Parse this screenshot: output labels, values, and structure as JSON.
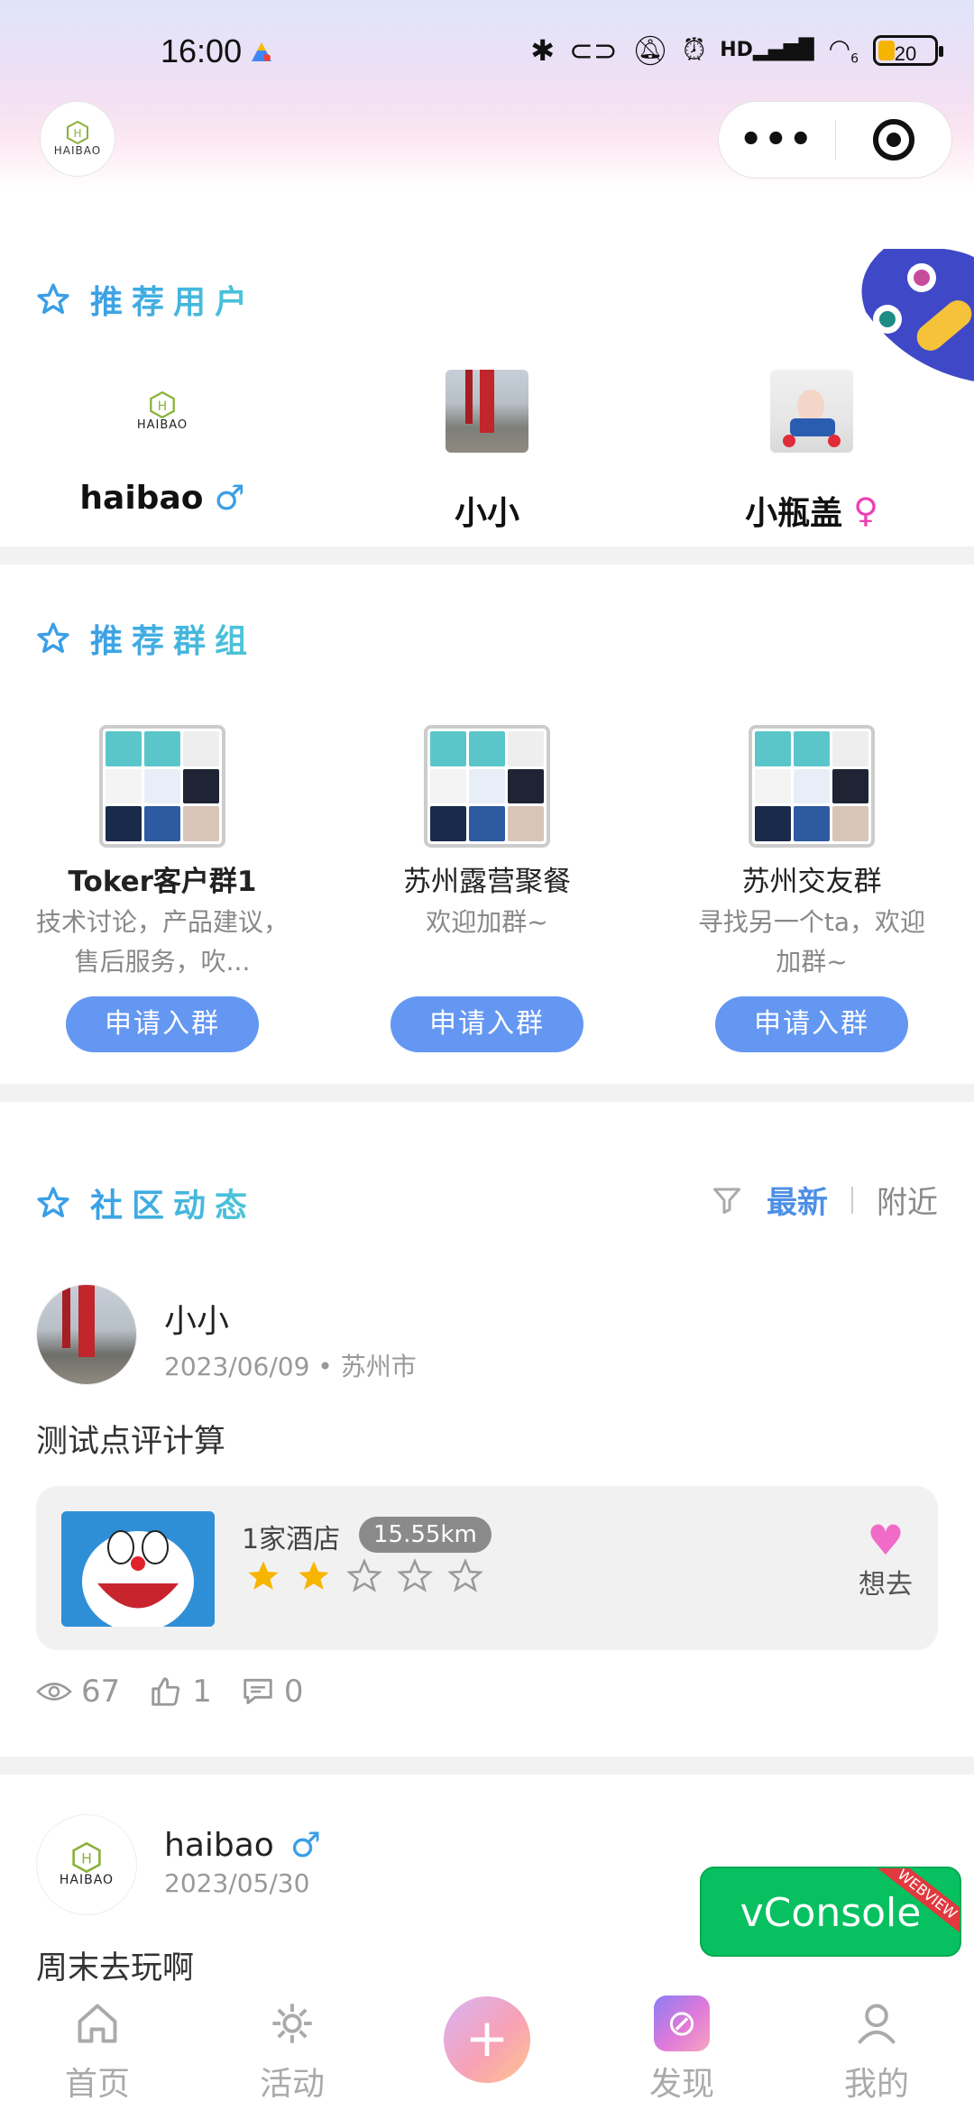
{
  "status_bar": {
    "time": "16:00",
    "battery": "20",
    "signal_label": "HD",
    "wifi_label": "6"
  },
  "header": {
    "logo_text": "HAIBAO"
  },
  "recommend_users": {
    "title": "推荐用户",
    "users": [
      {
        "name": "haibao",
        "gender": "male"
      },
      {
        "name": "小小"
      },
      {
        "name": "小瓶盖",
        "gender": "female"
      }
    ]
  },
  "recommend_groups": {
    "title": "推荐群组",
    "groups": [
      {
        "name": "Toker客户群1",
        "desc": "技术讨论，产品建议，售后服务，吹...",
        "button": "申请入群"
      },
      {
        "name": "苏州露营聚餐",
        "desc": "欢迎加群~",
        "button": "申请入群"
      },
      {
        "name": "苏州交友群",
        "desc": "寻找另一个ta，欢迎加群~",
        "button": "申请入群"
      }
    ]
  },
  "feed": {
    "title": "社区动态",
    "tabs": {
      "active": "最新",
      "inactive": "附近"
    },
    "posts": [
      {
        "author": "小小",
        "date": "2023/06/09",
        "location": "苏州市",
        "text": "测试点评计算",
        "card": {
          "title": "1家酒店",
          "distance": "15.55km",
          "rating": 2,
          "rating_max": 5,
          "want_label": "想去"
        },
        "stats": {
          "views": "67",
          "likes": "1",
          "comments": "0"
        }
      },
      {
        "author": "haibao",
        "author_gender": "male",
        "date": "2023/05/30",
        "text": "周末去玩啊"
      }
    ]
  },
  "vconsole": {
    "label": "vConsole",
    "ribbon": "WEBVIEW"
  },
  "bottom_nav": {
    "items": [
      {
        "label": "首页",
        "icon": "home-icon"
      },
      {
        "label": "活动",
        "icon": "activity-icon"
      },
      {
        "label": "",
        "icon": "plus-icon"
      },
      {
        "label": "发现",
        "icon": "discover-icon"
      },
      {
        "label": "我的",
        "icon": "profile-icon"
      }
    ]
  },
  "colors": {
    "accent": "#4d8fe6",
    "join_button": "#6497f2",
    "male": "#3b9fe6",
    "female": "#ee3fb5",
    "star": "#f7b500",
    "vconsole": "#07c160"
  }
}
